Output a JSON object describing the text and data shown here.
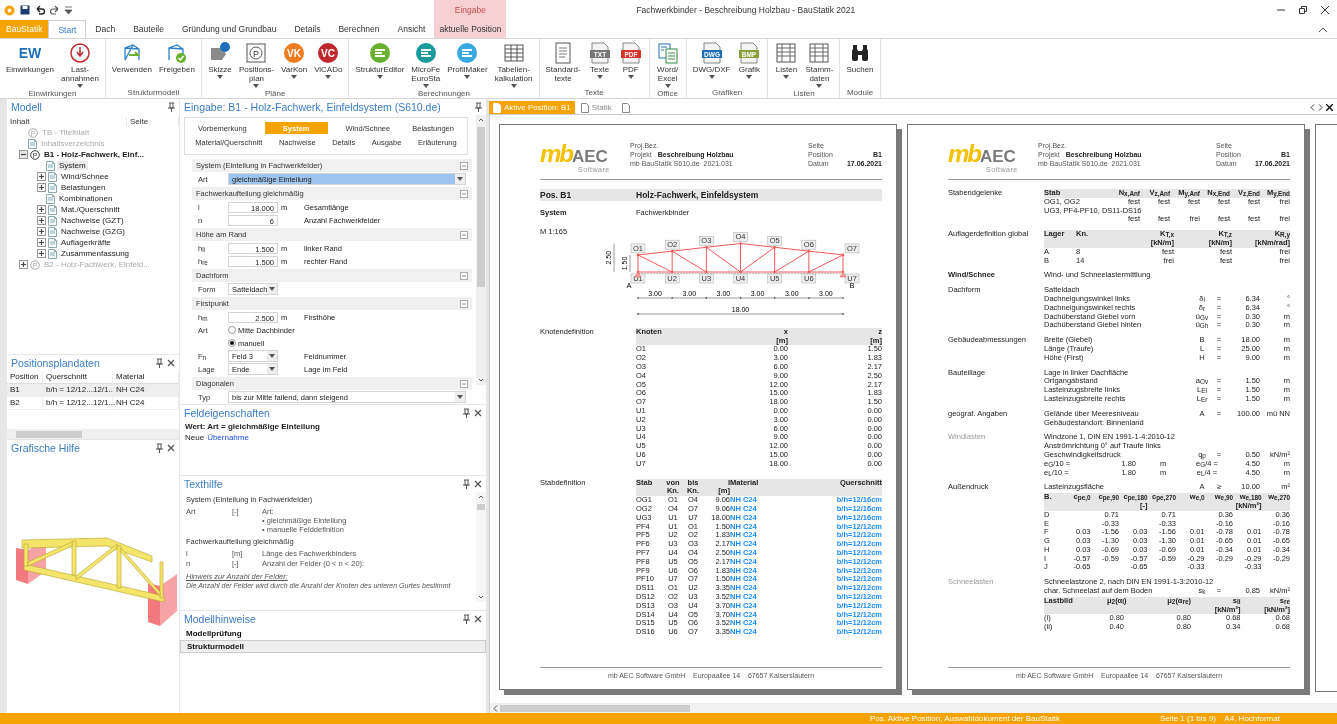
{
  "title_bar": {
    "title": "Fachwerkbinder - Beschreibung Holzbau - BauStatik 2021",
    "context_group": "Eingabe"
  },
  "ribbon_tabs": [
    {
      "label": "BauStatik",
      "kind": "file",
      "selected": false
    },
    {
      "label": "Start",
      "kind": "tab",
      "selected": true
    },
    {
      "label": "Dach",
      "kind": "tab",
      "selected": false
    },
    {
      "label": "Bauteile",
      "kind": "tab",
      "selected": false
    },
    {
      "label": "Gründung und Grundbau",
      "kind": "tab",
      "selected": false
    },
    {
      "label": "Details",
      "kind": "tab",
      "selected": false
    },
    {
      "label": "Berechnen",
      "kind": "tab",
      "selected": false
    },
    {
      "label": "Ansicht",
      "kind": "tab",
      "selected": false
    },
    {
      "label": "aktuelle Position",
      "kind": "context",
      "selected": false
    }
  ],
  "ribbon_groups": [
    {
      "name": "Einwirkungen",
      "buttons": [
        {
          "label": "Einwirkungen",
          "badge": "EW",
          "dropdown": false
        },
        {
          "label": "Last-\nannahmen",
          "dropdown": true
        }
      ]
    },
    {
      "name": "Strukturmodell",
      "buttons": [
        {
          "label": "Verwenden",
          "dropdown": false
        },
        {
          "label": "Freigeben",
          "dropdown": false
        }
      ]
    },
    {
      "name": "Pläne",
      "buttons": [
        {
          "label": "Skizze",
          "dropdown": true
        },
        {
          "label": "Positions-\nplan",
          "badge": "P",
          "dropdown": true
        },
        {
          "label": "VarKon",
          "badge": "VK",
          "dropdown": true
        },
        {
          "label": "ViCADo",
          "badge": "VC",
          "dropdown": true
        }
      ]
    },
    {
      "name": "Berechnungen",
      "buttons": [
        {
          "label": "StrukturEditor",
          "dropdown": true
        },
        {
          "label": "MicroFe\nEuroSta",
          "dropdown": true
        },
        {
          "label": "ProfilMaker",
          "dropdown": true
        },
        {
          "label": "Tabellen-\nkalkulation",
          "dropdown": true
        }
      ]
    },
    {
      "name": "Texte",
      "buttons": [
        {
          "label": "Standard-\ntexte",
          "dropdown": false
        },
        {
          "label": "Texte",
          "badge": "TXT",
          "dropdown": true
        },
        {
          "label": "PDF",
          "badge": "PDF",
          "dropdown": true
        }
      ]
    },
    {
      "name": "Office",
      "buttons": [
        {
          "label": "Word/\nExcel",
          "dropdown": true
        }
      ]
    },
    {
      "name": "Grafiken",
      "buttons": [
        {
          "label": "DWG/DXF",
          "badge": "DWG",
          "dropdown": true
        },
        {
          "label": "Grafik",
          "badge": "BMP",
          "dropdown": true
        }
      ]
    },
    {
      "name": "Listen",
      "buttons": [
        {
          "label": "Listen",
          "dropdown": true
        },
        {
          "label": "Stamm-\ndaten",
          "dropdown": true
        }
      ]
    },
    {
      "name": "Module",
      "buttons": [
        {
          "label": "Suchen",
          "dropdown": false
        }
      ]
    }
  ],
  "model_panel": {
    "title": "Modell",
    "columns": [
      "Inhalt",
      "Seite"
    ],
    "tree": [
      {
        "label": "TB - Titelblatt",
        "badge": "P",
        "disabled": true,
        "selected": false
      },
      {
        "label": "Inhaltsverzeichnis",
        "disabled": true,
        "selected": false
      },
      {
        "label": "B1 - Holz-Fachwerk, Einf...",
        "badge": "P",
        "disabled": false,
        "selected": false,
        "expanded": true,
        "children": [
          {
            "label": "System",
            "disabled": false,
            "selected": true
          },
          {
            "label": "Wind/Schnee",
            "disabled": false,
            "selected": false,
            "expanded": false
          },
          {
            "label": "Belastungen",
            "disabled": false,
            "selected": false,
            "expanded": false
          },
          {
            "label": "Kombinationen",
            "disabled": false,
            "selected": false
          },
          {
            "label": "Mat./Querschnitt",
            "disabled": false,
            "selected": false,
            "expanded": false
          },
          {
            "label": "Nachweise (GZT)",
            "disabled": false,
            "selected": false,
            "expanded": false
          },
          {
            "label": "Nachweise (GZG)",
            "disabled": false,
            "selected": false,
            "expanded": false
          },
          {
            "label": "Auflagerkräfte",
            "disabled": false,
            "selected": false,
            "expanded": false
          },
          {
            "label": "Zusammenfassung",
            "disabled": false,
            "selected": false,
            "expanded": false
          }
        ]
      },
      {
        "label": "B2 - Holz-Fachwerk, Einfeld...",
        "badge": "P",
        "disabled": true,
        "selected": false,
        "expanded": false
      }
    ]
  },
  "position_panel": {
    "title": "Positionsplandaten",
    "columns": [
      "Position",
      "Querschnitt",
      "Material"
    ],
    "rows": [
      {
        "cells": [
          "B1",
          "b/h = 12/12...12/1...",
          "NH C24"
        ],
        "selected": true
      },
      {
        "cells": [
          "B2",
          "b/h = 12/12...12/1...",
          "NH C24"
        ],
        "selected": false
      }
    ]
  },
  "graphic_panel": {
    "title": "Grafische Hilfe"
  },
  "input_panel": {
    "title": "Eingabe: B1 - Holz-Fachwerk, Einfeldsystem (S610.de)",
    "tab_rows": [
      [
        {
          "label": "Vorbemerkung",
          "selected": false
        },
        {
          "label": "System",
          "selected": true
        },
        {
          "label": "Wind/Schnee",
          "selected": false
        },
        {
          "label": "Belastungen",
          "selected": false
        }
      ],
      [
        {
          "label": "Material/Querschnitt",
          "selected": false
        },
        {
          "label": "Nachweise",
          "selected": false
        },
        {
          "label": "Details",
          "selected": false
        },
        {
          "label": "Ausgabe",
          "selected": false
        },
        {
          "label": "Erläuterung",
          "selected": false
        }
      ]
    ],
    "sections": [
      {
        "title": "System (Einteilung in Fachwerkfelder)",
        "rows": [
          {
            "kind": "select",
            "label": "Art",
            "value": "gleichmäßige Einteilung",
            "highlighted": true
          }
        ]
      },
      {
        "title": "Fachwerkaufteilung gleichmäßig",
        "rows": [
          {
            "kind": "number",
            "label": "l",
            "value": "18.000",
            "unit": "m",
            "desc": "Gesamtlänge"
          },
          {
            "kind": "number",
            "label": "n",
            "value": "6",
            "desc": "Anzahl Fachwerkfelder"
          }
        ]
      },
      {
        "title": "Höhe am Rand",
        "rows": [
          {
            "kind": "number",
            "label": "h$_{li}$",
            "value": "1.500",
            "unit": "m",
            "desc": "linker Rand"
          },
          {
            "kind": "number",
            "label": "h$_{re}$",
            "value": "1.500",
            "unit": "m",
            "desc": "rechter Rand"
          }
        ]
      },
      {
        "title": "Dachform",
        "rows": [
          {
            "kind": "choice",
            "label": "Form",
            "value": "Satteldach"
          }
        ]
      },
      {
        "title": "Firstpunkt",
        "rows": [
          {
            "kind": "number",
            "label": "h$_{m}$",
            "value": "2.500",
            "unit": "m",
            "desc": "Firsthöhe"
          },
          {
            "kind": "radio",
            "label": "Art",
            "option": "Mitte Dachbinder",
            "selected": false
          },
          {
            "kind": "radio",
            "option": "manuell",
            "selected": true
          },
          {
            "kind": "choice",
            "label": "F$_{n}$",
            "value": "Feld 3",
            "desc": "Feldnummer"
          },
          {
            "kind": "choice",
            "label": "Lage",
            "value": "Ende",
            "desc": "Lage im Feld"
          }
        ]
      },
      {
        "title": "Diagonalen",
        "rows": [
          {
            "kind": "select",
            "label": "Typ",
            "value": "bis zur Mitte fallend, dann steigend",
            "highlighted": false
          }
        ]
      }
    ]
  },
  "field_panel": {
    "title": "Feldeigenschaften",
    "value_line": "Wert: Art = gleichmäßige Einteilung",
    "new_label": "Neue",
    "new_link": "Übernahme"
  },
  "text_help": {
    "title": "Texthilfe",
    "lines": [
      {
        "kind": "heading",
        "text": "System (Einteilung in Fachwerkfelder)"
      },
      {
        "kind": "entry",
        "symbol": "Art",
        "unit": "[-]",
        "text": [
          "Art:",
          "• gleichmäßige Einteilung",
          "• manuelle Felddefinition"
        ]
      },
      {
        "kind": "heading",
        "text": "Fachwerkaufteilung gleichmäßig"
      },
      {
        "kind": "entry",
        "symbol": "l",
        "unit": "[m]",
        "text": [
          "Länge des Fachwerkbinders"
        ]
      },
      {
        "kind": "entry",
        "symbol": "n",
        "unit": "[-]",
        "text": [
          "Anzahl der Felder (0 < n < 20):"
        ]
      },
      {
        "kind": "note_title",
        "text": "Hinweis zur Anzahl der Felder:"
      },
      {
        "kind": "note",
        "text": "Die Anzahl der Felder wird durch die Anzahl der Knoten des unteren Gurtes bestimmt"
      }
    ]
  },
  "hints_panel": {
    "title": "Modellhinweise",
    "items": [
      {
        "label": "Modellprüfung",
        "selected": false
      },
      {
        "label": "Strukturmodell",
        "selected": true
      }
    ]
  },
  "doc_tabs": [
    {
      "label": "Aktive Position: B1",
      "selected": true
    },
    {
      "label": "Statik",
      "selected": false
    },
    {
      "selected": false
    }
  ],
  "pages": [
    {
      "header": {
        "logo_mark": "mb",
        "logo_name": "AEC",
        "logo_tagline": "Software",
        "proj_label": "Proj.Bez.",
        "project_label": "Projekt",
        "project": "Beschreibung Holzbau",
        "module": "mb BauStatik S610.de  2021.031",
        "page_label": "Seite",
        "position_label": "Position",
        "position": "B1",
        "date_label": "Datum",
        "date": "17.06.2021"
      },
      "pos_bar": {
        "label": "Pos. B1",
        "title": "Holz-Fachwerk, Einfeldsystem"
      },
      "blocks": [
        {
          "label": "System",
          "label_bold": true,
          "label_muted": false,
          "items": [
            {
              "kind": "text",
              "text": "Fachwerkbinder"
            }
          ]
        },
        {
          "label": "M 1:165",
          "label_bold": false,
          "label_muted": false,
          "items": [
            {
              "kind": "truss",
              "node_labels": [
                "O1",
                "O2",
                "O3",
                "O4",
                "O5",
                "O6",
                "O7",
                "U1",
                "U2",
                "U3",
                "U4",
                "U5",
                "U6",
                "U7"
              ],
              "spans": [
                "3.00",
                "3.00",
                "3.00",
                "3.00",
                "3.00",
                "3.00"
              ],
              "total": "18.00",
              "heights": [
                "2.50",
                "1.50"
              ],
              "supports": [
                "A",
                "B"
              ]
            }
          ]
        },
        {
          "label": "Knotendefinition",
          "label_bold": false,
          "label_muted": false,
          "items": [
            {
              "kind": "nodes",
              "columns": [
                {
                  "label": "Knoten"
                },
                {
                  "label": "x",
                  "unit": "[m]"
                },
                {
                  "label": "z",
                  "unit": "[m]"
                }
              ],
              "rows": [
                [
                  "O1",
                  "0.00",
                  "1.50"
                ],
                [
                  "O2",
                  "3.00",
                  "1.83"
                ],
                [
                  "O3",
                  "6.00",
                  "2.17"
                ],
                [
                  "O4",
                  "9.00",
                  "2.50"
                ],
                [
                  "O5",
                  "12.00",
                  "2.17"
                ],
                [
                  "O6",
                  "15.00",
                  "1.83"
                ],
                [
                  "O7",
                  "18.00",
                  "1.50"
                ],
                [
                  "U1",
                  "0.00",
                  "0.00"
                ],
                [
                  "U2",
                  "3.00",
                  "0.00"
                ],
                [
                  "U3",
                  "6.00",
                  "0.00"
                ],
                [
                  "U4",
                  "9.00",
                  "0.00"
                ],
                [
                  "U5",
                  "12.00",
                  "0.00"
                ],
                [
                  "U6",
                  "15.00",
                  "0.00"
                ],
                [
                  "U7",
                  "18.00",
                  "0.00"
                ]
              ]
            }
          ]
        },
        {
          "label": "Stabdefinition",
          "label_bold": false,
          "label_muted": false,
          "items": [
            {
              "kind": "bars",
              "columns": [
                {
                  "label": "Stab"
                },
                {
                  "label": "von",
                  "unit": "Kn."
                },
                {
                  "label": "bis",
                  "unit": "Kn."
                },
                {
                  "label": "l",
                  "unit": "[m]"
                },
                {
                  "label": "Material"
                },
                {
                  "label": "Querschnitt"
                }
              ],
              "rows": [
                [
                  "OG1",
                  "O1",
                  "O4",
                  "9.06",
                  "NH C24",
                  "b/h=12/16cm"
                ],
                [
                  "OG2",
                  "O4",
                  "O7",
                  "9.06",
                  "NH C24",
                  "b/h=12/16cm"
                ],
                [
                  "UG3",
                  "U1",
                  "U7",
                  "18.00",
                  "NH C24",
                  "b/h=12/16cm"
                ],
                [
                  "PF4",
                  "U1",
                  "O1",
                  "1.50",
                  "NH C24",
                  "b/h=12/12cm"
                ],
                [
                  "PF5",
                  "U2",
                  "O2",
                  "1.83",
                  "NH C24",
                  "b/h=12/12cm"
                ],
                [
                  "PF6",
                  "U3",
                  "O3",
                  "2.17",
                  "NH C24",
                  "b/h=12/12cm"
                ],
                [
                  "PF7",
                  "U4",
                  "O4",
                  "2.50",
                  "NH C24",
                  "b/h=12/12cm"
                ],
                [
                  "PF8",
                  "U5",
                  "O5",
                  "2.17",
                  "NH C24",
                  "b/h=12/12cm"
                ],
                [
                  "PF9",
                  "U6",
                  "O6",
                  "1.83",
                  "NH C24",
                  "b/h=12/12cm"
                ],
                [
                  "PF10",
                  "U7",
                  "O7",
                  "1.50",
                  "NH C24",
                  "b/h=12/12cm"
                ],
                [
                  "DS11",
                  "O1",
                  "U2",
                  "3.35",
                  "NH C24",
                  "b/h=12/12cm"
                ],
                [
                  "DS12",
                  "O2",
                  "U3",
                  "3.52",
                  "NH C24",
                  "b/h=12/12cm"
                ],
                [
                  "DS13",
                  "O3",
                  "U4",
                  "3.70",
                  "NH C24",
                  "b/h=12/12cm"
                ],
                [
                  "DS14",
                  "U4",
                  "O5",
                  "3.70",
                  "NH C24",
                  "b/h=12/12cm"
                ],
                [
                  "DS15",
                  "U5",
                  "O6",
                  "3.52",
                  "NH C24",
                  "b/h=12/12cm"
                ],
                [
                  "DS16",
                  "U6",
                  "O7",
                  "3.35",
                  "NH C24",
                  "b/h=12/12cm"
                ]
              ]
            }
          ]
        }
      ],
      "footer": "mb AEC Software GmbH    Europaallee 14    67657 Kaiserslautern"
    },
    {
      "header": {
        "logo_mark": "mb",
        "logo_name": "AEC",
        "logo_tagline": "Software",
        "proj_label": "Proj.Bez.",
        "project_label": "Projekt",
        "project": "Beschreibung Holzbau",
        "module": "mb BauStatik S610.de  2021.031",
        "page_label": "Seite",
        "position_label": "Position",
        "position": "B1",
        "date_label": "Datum",
        "date": "17.06.2021"
      },
      "blocks": [
        {
          "label": "Stabendgelenke",
          "label_bold": false,
          "label_muted": false,
          "items": [
            {
              "kind": "hinges",
              "columns": [
                {
                  "label": "Stab"
                },
                {
                  "label": "N$_{x,Anf}$"
                },
                {
                  "label": "V$_{z,Anf}$"
                },
                {
                  "label": "M$_{y,Anf}$"
                },
                {
                  "label": "N$_{x,End}$"
                },
                {
                  "label": "V$_{z,End}$"
                },
                {
                  "label": "M$_{y,End}$"
                }
              ],
              "rows": [
                [
                  "OG1, OG2",
                  "fest",
                  "fest",
                  "fest",
                  "fest",
                  "fest",
                  "frei"
                ],
                [
                  "UG3, PF4-PF10, DS11-DS16"
                ],
                [
                  null,
                  "fest",
                  "fest",
                  "frei",
                  "fest",
                  "fest",
                  "frei"
                ]
              ]
            }
          ]
        },
        {
          "label": "Auflagerdefinition global",
          "label_bold": false,
          "label_muted": false,
          "items": [
            {
              "kind": "supports",
              "columns": [
                {
                  "label": "Lager"
                },
                {
                  "label": "Kn."
                },
                {
                  "label": "K$_{T,x}$",
                  "unit": "[kN/m]"
                },
                {
                  "label": "K$_{T,z}$",
                  "unit": "[kN/m]"
                },
                {
                  "label": "K$_{R,y}$",
                  "unit": "[kNm/rad]"
                }
              ],
              "rows": [
                [
                  "A",
                  "8",
                  "fest",
                  "fest",
                  "frei"
                ],
                [
                  "B",
                  "14",
                  "frei",
                  "fest",
                  "frei"
                ]
              ]
            }
          ]
        },
        {
          "label": "Wind/Schnee",
          "label_bold": true,
          "label_muted": false,
          "items": [
            {
              "kind": "text",
              "text": "Wind- und Schneelastermittlung"
            }
          ]
        },
        {
          "label": "Dachform",
          "label_bold": false,
          "label_muted": false,
          "items": [
            {
              "kind": "params",
              "rows": [
                {
                  "text": "Satteldach"
                },
                {
                  "text": "Dachneigungswinkel links",
                  "symbol": "δ$_{l}$",
                  "op": "=",
                  "value": "6.34",
                  "unit": "°"
                },
                {
                  "text": "Dachneigungswinkel rechts",
                  "symbol": "δ$_{r}$",
                  "op": "=",
                  "value": "6.34",
                  "unit": "°"
                },
                {
                  "text": "Dachüberstand Giebel vorn",
                  "symbol": "ü$_{Gv}$",
                  "op": "=",
                  "value": "0.30",
                  "unit": "m"
                },
                {
                  "text": "Dachüberstand Giebel hinten",
                  "symbol": "ü$_{Gh}$",
                  "op": "=",
                  "value": "0.30",
                  "unit": "m"
                }
              ]
            }
          ]
        },
        {
          "label": "Gebäudeabmessungen",
          "label_bold": false,
          "label_muted": false,
          "items": [
            {
              "kind": "params",
              "rows": [
                {
                  "text": "Breite (Giebel)",
                  "symbol": "B",
                  "op": "=",
                  "value": "18.00",
                  "unit": "m"
                },
                {
                  "text": "Länge (Traufe)",
                  "symbol": "L",
                  "op": "=",
                  "value": "25.00",
                  "unit": "m"
                },
                {
                  "text": "Höhe (First)",
                  "symbol": "H",
                  "op": "=",
                  "value": "9.00",
                  "unit": "m"
                }
              ]
            }
          ]
        },
        {
          "label": "Bauteillage",
          "label_bold": false,
          "label_muted": false,
          "items": [
            {
              "kind": "params",
              "rows": [
                {
                  "text": "Lage in linker Dachfläche"
                },
                {
                  "text": "Ortgangabstand",
                  "symbol": "a$_{Ov}$",
                  "op": "=",
                  "value": "1.50",
                  "unit": "m"
                },
                {
                  "text": "Lasteinzugsbreite links",
                  "symbol": "L$_{El}$",
                  "op": "=",
                  "value": "1.50",
                  "unit": "m"
                },
                {
                  "text": "Lasteinzugsbreite rechts",
                  "symbol": "L$_{Er}$",
                  "op": "=",
                  "value": "1.50",
                  "unit": "m"
                }
              ]
            }
          ]
        },
        {
          "label": "geograf. Angaben",
          "label_bold": false,
          "label_muted": false,
          "items": [
            {
              "kind": "params",
              "rows": [
                {
                  "text": "Gelände über Meeresniveau",
                  "symbol": "A",
                  "op": "=",
                  "value": "100.00",
                  "unit": "mü NN"
                },
                {
                  "text": "Gebäudestandort: Binnenland"
                }
              ]
            }
          ]
        },
        {
          "label": "Windlasten",
          "label_bold": false,
          "label_muted": true,
          "items": [
            {
              "kind": "params",
              "rows": [
                {
                  "text": "Windzone 1, DIN EN 1991-1-4:2010-12"
                },
                {
                  "text": "Anströmrichtung 0° auf Traufe links"
                },
                {
                  "text": "Geschwindigkeitsdruck",
                  "symbol": "q$_{p}$",
                  "op": "=",
                  "value": "0.50",
                  "unit": "kN/m²"
                },
                {
                  "text": "e$_{G}$/10 =",
                  "mid_value": "1.80",
                  "mid_unit": "m",
                  "symbol": "e$_{G}$/4 =",
                  "value": "4.50",
                  "unit": "m"
                },
                {
                  "text": "e$_{L}$/10 =",
                  "mid_value": "1.80",
                  "mid_unit": "m",
                  "symbol": "e$_{L}$/4 =",
                  "value": "4.50",
                  "unit": "m"
                }
              ]
            }
          ]
        },
        {
          "label": "Außendruck",
          "label_bold": false,
          "label_muted": false,
          "items": [
            {
              "kind": "params",
              "rows": [
                {
                  "text": "Lasteinzugsfläche",
                  "symbol": "A",
                  "op": "≥",
                  "value": "10.00",
                  "unit": "m²"
                }
              ]
            },
            {
              "kind": "pressure",
              "columns": [
                {
                  "label": "B."
                },
                {
                  "label": "c$_{pe,0}$"
                },
                {
                  "label": "c$_{pe,90}$"
                },
                {
                  "label": "c$_{pe,180}$",
                  "unit": "[-]"
                },
                {
                  "label": "c$_{pe,270}$"
                },
                {
                  "label": "w$_{e,0}$"
                },
                {
                  "label": "w$_{e,90}$"
                },
                {
                  "label": "w$_{e,180}$",
                  "unit": "[kN/m²]"
                },
                {
                  "label": "w$_{e,270}$"
                }
              ],
              "rows": [
                [
                  "D",
                  null,
                  "0.71",
                  null,
                  "0.71",
                  null,
                  "0.36",
                  null,
                  "0.36"
                ],
                [
                  "E",
                  null,
                  "-0.33",
                  null,
                  "-0.33",
                  null,
                  "-0.16",
                  null,
                  "-0.16"
                ],
                [
                  "F",
                  "0.03",
                  "-1.56",
                  "0.03",
                  "-1.56",
                  "0.01",
                  "-0.78",
                  "0.01",
                  "-0.78"
                ],
                [
                  "G",
                  "0.03",
                  "-1.30",
                  "0.03",
                  "-1.30",
                  "0.01",
                  "-0.65",
                  "0.01",
                  "-0.65"
                ],
                [
                  "H",
                  "0.03",
                  "-0.69",
                  "0.03",
                  "-0.69",
                  "0.01",
                  "-0.34",
                  "0.01",
                  "-0.34"
                ],
                [
                  "I",
                  "-0.57",
                  "-0.59",
                  "-0.57",
                  "-0.59",
                  "-0.29",
                  "-0.29",
                  "-0.29",
                  "-0.29"
                ],
                [
                  "J",
                  "-0.65",
                  null,
                  "-0.65",
                  null,
                  "-0.33",
                  null,
                  "-0.33",
                  null
                ]
              ]
            }
          ]
        },
        {
          "label": "Schneelasten",
          "label_bold": false,
          "label_muted": true,
          "items": [
            {
              "kind": "params",
              "rows": [
                {
                  "text": "Schneelastzone 2, nach DIN EN 1991-1-3:2010-12"
                },
                {
                  "text": "char. Schneelast auf dem Boden",
                  "symbol": "s$_{k}$",
                  "op": "=",
                  "value": "0.85",
                  "unit": "kN/m²"
                }
              ]
            },
            {
              "kind": "snow",
              "columns": [
                {
                  "label": "Lastbild"
                },
                {
                  "label": "μ$_{2}$(α$_{l}$)"
                },
                {
                  "label": "μ$_{2}$(α$_{re}$)"
                },
                {
                  "label": "s$_{li}$",
                  "unit": "[kN/m²]"
                },
                {
                  "label": "s$_{re}$",
                  "unit": "[kN/m²]"
                }
              ],
              "rows": [
                [
                  "(i)",
                  "0.80",
                  "0.80",
                  "0.68",
                  "0.68"
                ],
                [
                  "(ii)",
                  "0.40",
                  "0.80",
                  "0.34",
                  "0.68"
                ]
              ]
            }
          ]
        }
      ],
      "footer": "mb AEC Software GmbH    Europaallee 14    67657 Kaiserslautern"
    }
  ],
  "status_bar": {
    "left": "Pos. Aktive Position, Auswahldokument der BauStatik",
    "right": "Seite 1 (1 bis 9)    A4, Hochformat"
  }
}
